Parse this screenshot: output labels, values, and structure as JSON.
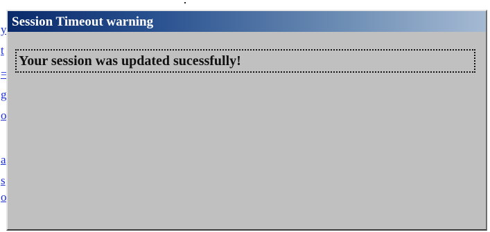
{
  "background": {
    "link_fragments": [
      "y",
      "t",
      "=",
      "g",
      "o",
      "a",
      "s",
      "o"
    ]
  },
  "dialog": {
    "title": "Session Timeout warning",
    "message": "Your session was updated sucessfully!"
  },
  "colors": {
    "dialog_background": "#c0c0c0",
    "titlebar_start": "#0a2a6a",
    "titlebar_end": "#a5bad3",
    "title_text": "#ffffff",
    "link": "#1a2fd6"
  }
}
